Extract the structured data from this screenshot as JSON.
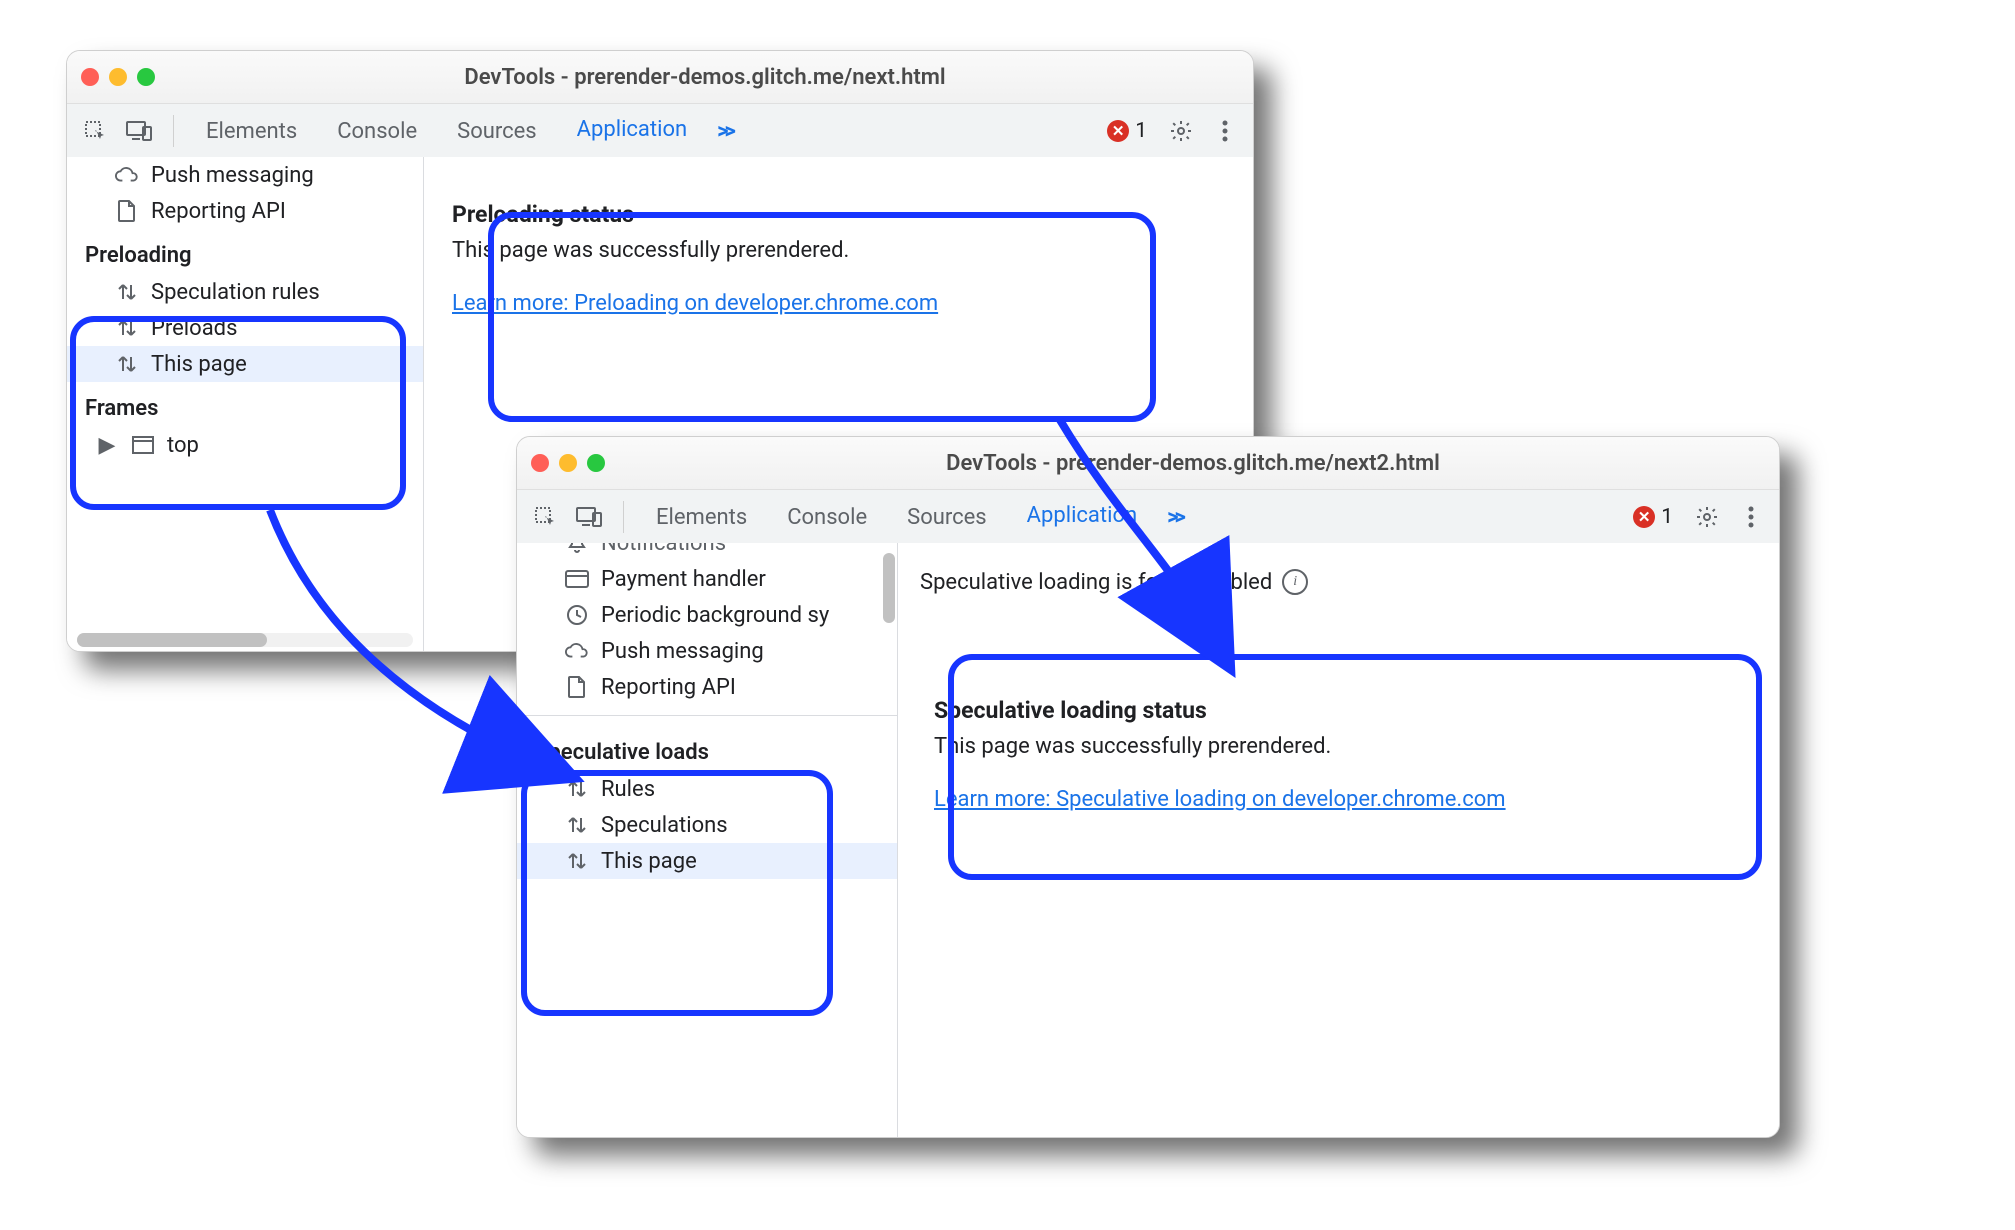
{
  "window1": {
    "title": "DevTools - prerender-demos.glitch.me/next.html",
    "tabs": {
      "elements": "Elements",
      "console": "Console",
      "sources": "Sources",
      "application": "Application"
    },
    "error_count": "1",
    "sidebar": {
      "push": "Push messaging",
      "reporting": "Reporting API",
      "category": "Preloading",
      "item1": "Speculation rules",
      "item2": "Preloads",
      "item3": "This page",
      "frames_cat": "Frames",
      "top": "top"
    },
    "panel": {
      "heading": "Preloading status",
      "text": "This page was successfully prerendered.",
      "link": "Learn more: Preloading on developer.chrome.com"
    }
  },
  "window2": {
    "title": "DevTools - prerender-demos.glitch.me/next2.html",
    "tabs": {
      "elements": "Elements",
      "console": "Console",
      "sources": "Sources",
      "application": "Application"
    },
    "error_count": "1",
    "sidebar": {
      "notifications": "Notifications",
      "payment": "Payment handler",
      "periodic": "Periodic background sy",
      "push": "Push messaging",
      "reporting": "Reporting API",
      "category": "Speculative loads",
      "item1": "Rules",
      "item2": "Speculations",
      "item3": "This page"
    },
    "status_line": "Speculative loading is force-enabled",
    "panel": {
      "heading": "Speculative loading status",
      "text": "This page was successfully prerendered.",
      "link": "Learn more: Speculative loading on developer.chrome.com"
    }
  }
}
